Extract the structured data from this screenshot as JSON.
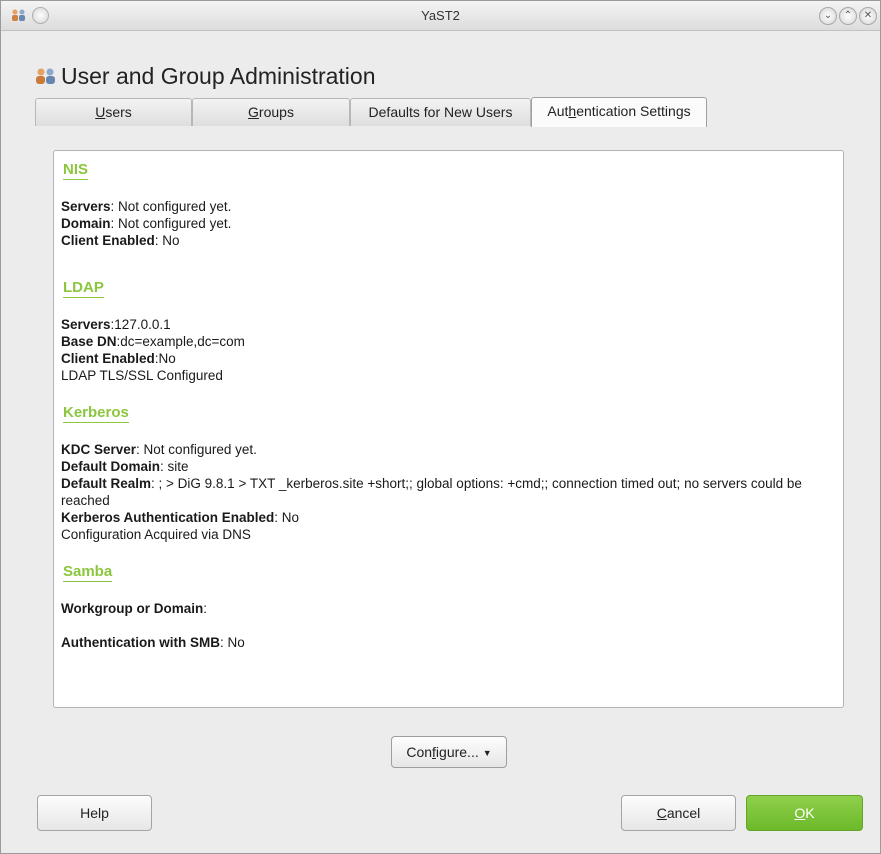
{
  "window": {
    "title": "YaST2",
    "buttons": [
      "minimize",
      "maximize",
      "close"
    ]
  },
  "header": {
    "title": "User and Group Administration",
    "icon": "users-icon"
  },
  "tabs": [
    {
      "label_pre": "",
      "mnemonic": "U",
      "label_post": "sers"
    },
    {
      "label_pre": "",
      "mnemonic": "G",
      "label_post": "roups"
    },
    {
      "label_pre": "Defaults for New Users",
      "mnemonic": "",
      "label_post": ""
    },
    {
      "label_pre": "Aut",
      "mnemonic": "h",
      "label_post": "entication Settings"
    }
  ],
  "sections": {
    "nis": {
      "title": "NIS",
      "servers_label": "Servers",
      "servers_value": ": Not configured yet.",
      "domain_label": "Domain",
      "domain_value": ": Not configured yet.",
      "client_label": "Client Enabled",
      "client_value": ": No"
    },
    "ldap": {
      "title": "LDAP",
      "servers_label": "Servers",
      "servers_value": ":127.0.0.1",
      "basedn_label": "Base DN",
      "basedn_value": ":dc=example,dc=com",
      "client_label": "Client Enabled",
      "client_value": ":No",
      "tls_text": "LDAP TLS/SSL Configured"
    },
    "kerberos": {
      "title": "Kerberos",
      "kdc_label": "KDC Server",
      "kdc_value": ": Not configured yet.",
      "domain_label": "Default Domain",
      "domain_value": ": site",
      "realm_label": "Default Realm",
      "realm_value": ": ; > DiG 9.8.1 > TXT _kerberos.site +short;; global options: +cmd;; connection timed out; no servers could be reached",
      "auth_label": "Kerberos Authentication Enabled",
      "auth_value": ": No",
      "dns_text": "Configuration Acquired via DNS"
    },
    "samba": {
      "title": "Samba",
      "workgroup_label": "Workgroup or Domain",
      "workgroup_value": ":",
      "smb_label": "Authentication with SMB",
      "smb_value": ": No"
    }
  },
  "buttons": {
    "configure_pre": "Con",
    "configure_mnemonic": "f",
    "configure_post": "igure...",
    "help": "Help",
    "cancel_mnemonic": "C",
    "cancel_post": "ancel",
    "ok_mnemonic": "O",
    "ok_post": "K"
  },
  "colors": {
    "accent_green": "#8cc63e",
    "ok_button": "#7cc43a"
  }
}
